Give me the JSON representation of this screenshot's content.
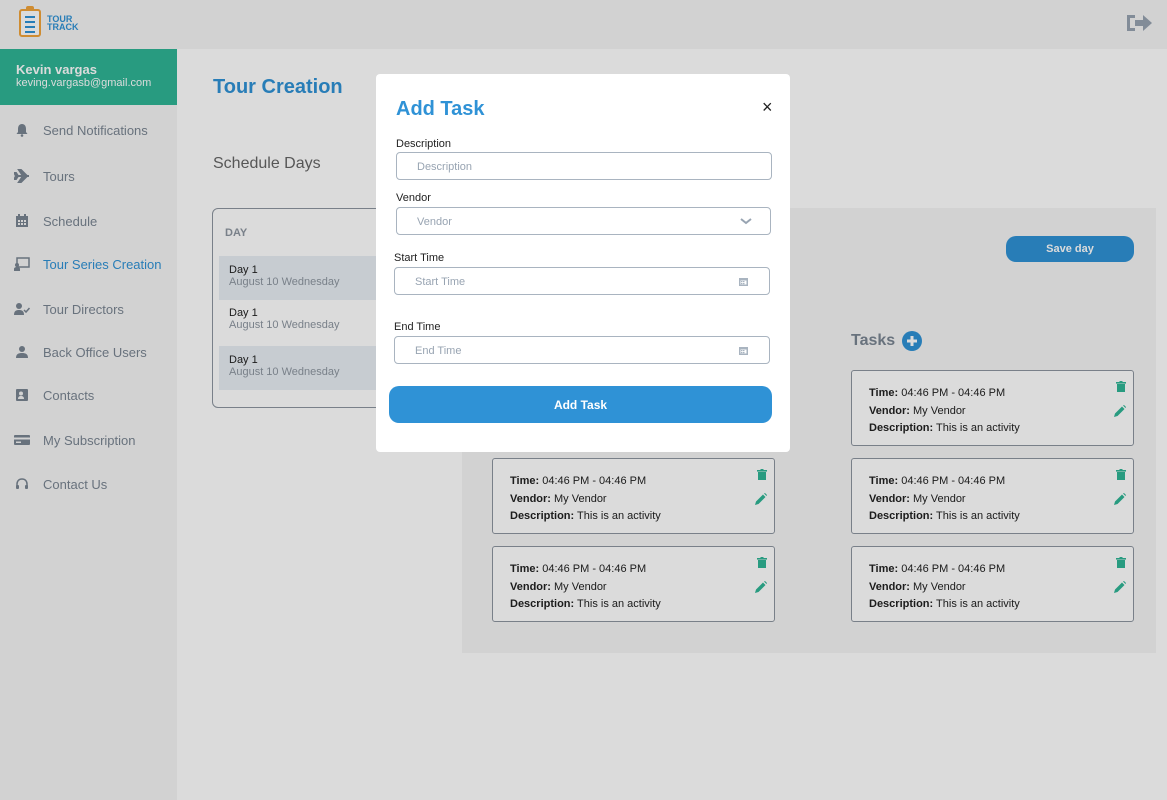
{
  "app": {
    "logo_line1": "TOUR",
    "logo_line2": "TRACK"
  },
  "user": {
    "name": "Kevin vargas",
    "email": "keving.vargasb@gmail.com"
  },
  "sidebar": {
    "items": [
      {
        "label": "Send Notifications",
        "icon": "bell-icon"
      },
      {
        "label": "Tours",
        "icon": "plane-icon"
      },
      {
        "label": "Schedule",
        "icon": "calendar-icon"
      },
      {
        "label": "Tour Series Creation",
        "icon": "presentation-icon",
        "active": true
      },
      {
        "label": "Tour Directors",
        "icon": "user-check-icon"
      },
      {
        "label": "Back Office Users",
        "icon": "users-icon"
      },
      {
        "label": "Contacts",
        "icon": "contact-card-icon"
      },
      {
        "label": "My Subscription",
        "icon": "credit-card-icon"
      },
      {
        "label": "Contact Us",
        "icon": "headset-icon"
      }
    ]
  },
  "main": {
    "title": "Tour Creation",
    "subtitle": "Schedule Days",
    "day_header": "DAY",
    "days": [
      {
        "title": "Day 1",
        "date": "August 10 Wednesday"
      },
      {
        "title": "Day 1",
        "date": "August 10 Wednesday"
      },
      {
        "title": "Day 1",
        "date": "August 10 Wednesday"
      }
    ],
    "save_day_label": "Save day",
    "tasks_label": "Tasks",
    "task_cards": [
      {
        "time_label": "Time:",
        "time": "04:46 PM - 04:46 PM",
        "vendor_label": "Vendor:",
        "vendor": "My Vendor",
        "desc_label": "Description:",
        "desc": "This is an activity"
      },
      {
        "time_label": "Time:",
        "time": "04:46 PM - 04:46 PM",
        "vendor_label": "Vendor:",
        "vendor": "My Vendor",
        "desc_label": "Description:",
        "desc": "This is an activity"
      },
      {
        "time_label": "Time:",
        "time": "04:46 PM - 04:46 PM",
        "vendor_label": "Vendor:",
        "vendor": "My Vendor",
        "desc_label": "Description:",
        "desc": "This is an activity"
      },
      {
        "time_label": "Time:",
        "time": "04:46 PM - 04:46 PM",
        "vendor_label": "Vendor:",
        "vendor": "My Vendor",
        "desc_label": "Description:",
        "desc": "This is an activity"
      },
      {
        "time_label": "Time:",
        "time": "04:46 PM - 04:46 PM",
        "vendor_label": "Vendor:",
        "vendor": "My Vendor",
        "desc_label": "Description:",
        "desc": "This is an activity"
      }
    ]
  },
  "modal": {
    "title": "Add Task",
    "close": "×",
    "description_label": "Description",
    "description_placeholder": "Description",
    "vendor_label": "Vendor",
    "vendor_placeholder": "Vendor",
    "start_label": "Start Time",
    "start_placeholder": "Start Time",
    "end_label": "End Time",
    "end_placeholder": "End Time",
    "submit_label": "Add Task"
  },
  "colors": {
    "primary": "#2f92d6",
    "accent": "#2fb596",
    "muted": "#7a8592"
  }
}
